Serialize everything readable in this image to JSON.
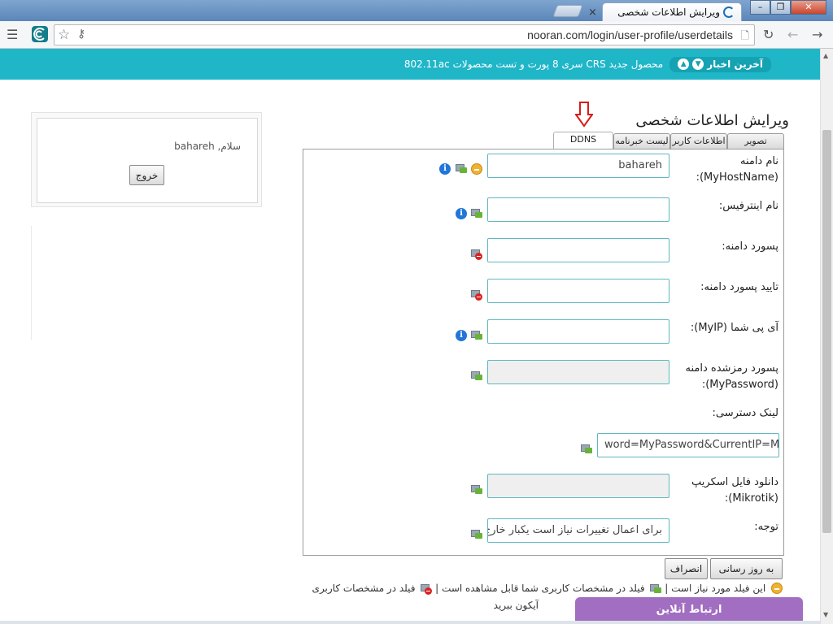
{
  "browser": {
    "tab_title": "ویرایش اطلاعات شخصی",
    "tab_close": "×",
    "url": "nooran.com/login/user-profile/userdetails"
  },
  "news": {
    "label": "آخرین اخبار",
    "text": "محصول جدید CRS سری 8 پورت و تست محصولات 802.11ac"
  },
  "page": {
    "title": "ویرایش اطلاعات شخصی"
  },
  "tabs": [
    {
      "label": "تصویر"
    },
    {
      "label": "اطلاعات کاربر"
    },
    {
      "label": "لیست خبرنامه"
    },
    {
      "label": "DDNS"
    }
  ],
  "form": {
    "hostname": {
      "label": "نام دامنه\n(MyHostName):",
      "value": "bahareh"
    },
    "interface": {
      "label": "نام اینترفیس:",
      "value": ""
    },
    "domain_password": {
      "label": "پسورد دامنه:",
      "value": ""
    },
    "confirm_password": {
      "label": "تایید پسورد دامنه:",
      "value": ""
    },
    "myip": {
      "label": "آی پی شما (MyIP):",
      "value": ""
    },
    "encrypted_password": {
      "label": "پسورد رمزشده دامنه\n(MyPassword):",
      "value": ""
    },
    "access_link": {
      "label": "لینک دسترسی:",
      "value": "word=MyPassword&CurrentIP=MyIP"
    },
    "script_download": {
      "label": "دانلود فایل اسکریپ\n(Mikrotik):",
      "value": ""
    },
    "note": {
      "label": "توجه:",
      "value": "برای اعمال تغییرات نیاز است یکبار خارج"
    }
  },
  "buttons": {
    "update": "به روز رسانی",
    "cancel": "انصراف",
    "logout": "خروج"
  },
  "legend": {
    "required": "این فیلد مورد نیاز است |",
    "visible": "فیلد در مشخصات کاربری شما قابل مشاهده است |",
    "hidden_line1": "فیلد در مشخصات کاربری",
    "hidden_line2": "آیکون ببرید"
  },
  "sidebar": {
    "greeting": "سلام, bahareh"
  },
  "chat": {
    "label": "ارتباط آنلاین"
  },
  "colors": {
    "accent": "#1fb6c8",
    "chat": "#a26ec1",
    "input_border": "#5fb8c2"
  }
}
